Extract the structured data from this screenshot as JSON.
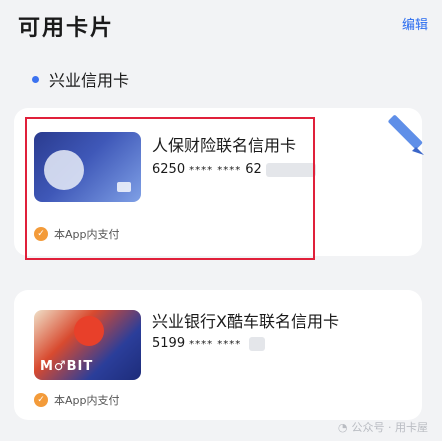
{
  "header": {
    "title": "可用卡片",
    "edit_label": "编辑"
  },
  "bank": {
    "name": "兴业信用卡"
  },
  "cards": [
    {
      "name": "人保财险联名信用卡",
      "number_prefix": "6250",
      "mask": "**** ****",
      "number_tail": "62",
      "pay_label": "本App内支付",
      "selected": true
    },
    {
      "name": "兴业银行X酷车联名信用卡",
      "number_prefix": "5199",
      "mask": "**** ****",
      "number_tail": "",
      "pay_label": "本App内支付",
      "art_text": "M♂BIT",
      "selected": false
    }
  ],
  "watermark": {
    "text": "公众号 · 用卡屋"
  },
  "colors": {
    "accent": "#2a6cf0",
    "selection": "#e0203a",
    "pay_badge": "#f39b3a"
  }
}
